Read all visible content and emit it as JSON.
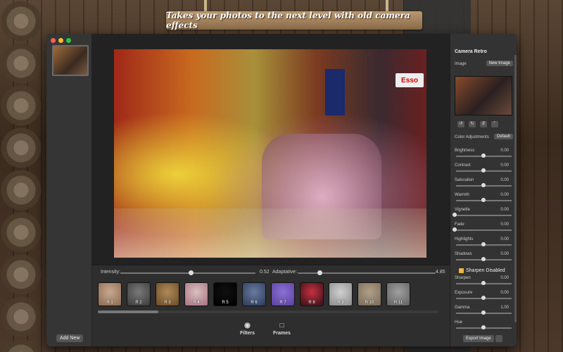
{
  "banner": {
    "text": "Takes your photos to the next level with old camera effects"
  },
  "colors": {
    "close": "#ff5f57",
    "minimize": "#febc2e",
    "zoom": "#28c840",
    "accent": "#e8b840"
  },
  "sidebar": {
    "add_new": "Add New"
  },
  "photo": {
    "sign_text": "Esso"
  },
  "sliders": {
    "intensity": {
      "label": "Intensity:",
      "value": "0.52",
      "fraction": 0.52
    },
    "adaptative": {
      "label": "Adaptative:",
      "value": "4.85",
      "fraction": 0.16
    }
  },
  "filters": [
    {
      "label": "R 1",
      "c1": "#c8a890",
      "c2": "#8a6a50"
    },
    {
      "label": "R 2",
      "c1": "#7a7a7a",
      "c2": "#3a3a3a"
    },
    {
      "label": "R 3",
      "c1": "#b08a58",
      "c2": "#6a4a28"
    },
    {
      "label": "R 4",
      "c1": "#d8c0c0",
      "c2": "#a87080"
    },
    {
      "label": "R 5",
      "c1": "#101010",
      "c2": "#000000"
    },
    {
      "label": "R 6",
      "c1": "#6a7aa0",
      "c2": "#2a3a5a"
    },
    {
      "label": "R 7",
      "c1": "#8a70d0",
      "c2": "#5a40a0"
    },
    {
      "label": "R 8",
      "c1": "#c83040",
      "c2": "#301018"
    },
    {
      "label": "R 9",
      "c1": "#d0d0d0",
      "c2": "#8a8a8a"
    },
    {
      "label": "R 10",
      "c1": "#b0a088",
      "c2": "#7a6a58"
    },
    {
      "label": "R 11",
      "c1": "#a0a0a0",
      "c2": "#606060"
    }
  ],
  "tabs": {
    "filters": "Filters",
    "frames": "Frames"
  },
  "right": {
    "title": "Camera Retro",
    "image_label": "Image",
    "new_image": "New Image",
    "color_adjustments": "Color Adjustments",
    "default": "Default",
    "adjustments": [
      {
        "label": "Brightness",
        "value": "0.00",
        "fraction": 0.5
      },
      {
        "label": "Contrast",
        "value": "0.00",
        "fraction": 0.5
      },
      {
        "label": "Saturation",
        "value": "0.00",
        "fraction": 0.5
      },
      {
        "label": "Warmth",
        "value": "0.00",
        "fraction": 0.5
      },
      {
        "label": "Vignette",
        "value": "0.00",
        "fraction": 0.0
      },
      {
        "label": "Fade",
        "value": "0.00",
        "fraction": 0.0
      },
      {
        "label": "Highlights",
        "value": "0.00",
        "fraction": 0.5
      },
      {
        "label": "Shadows",
        "value": "0.00",
        "fraction": 0.5
      }
    ],
    "sharpen_disabled": "Sharpen Disabled",
    "adjustments2": [
      {
        "label": "Sharpen",
        "value": "0.00",
        "fraction": 0.5
      },
      {
        "label": "Exposure",
        "value": "0.00",
        "fraction": 0.5
      },
      {
        "label": "Gamma",
        "value": "1.00",
        "fraction": 0.5
      },
      {
        "label": "Hue",
        "value": "",
        "fraction": 0.5
      }
    ],
    "export": "Export Image"
  }
}
